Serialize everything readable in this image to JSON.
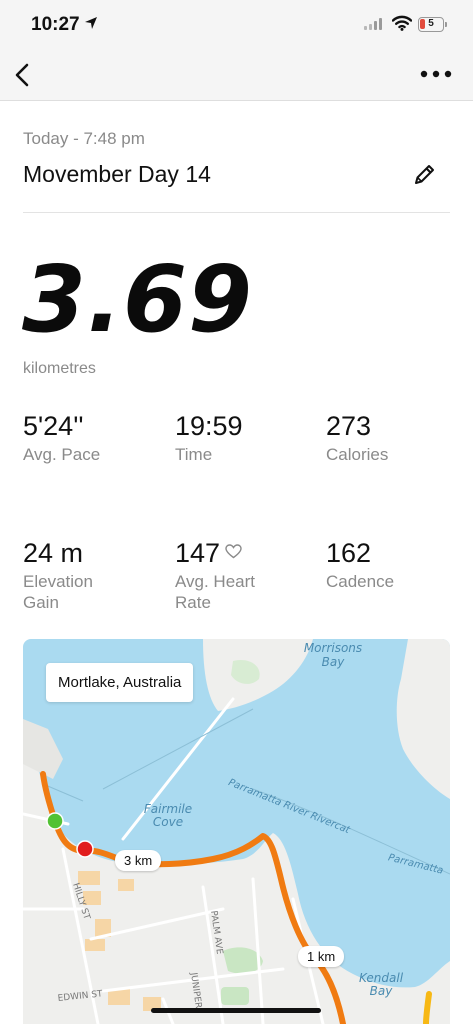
{
  "status_bar": {
    "time": "10:27",
    "battery_level": "5"
  },
  "activity": {
    "date": "Today - 7:48 pm",
    "title": "Movember Day 14",
    "distance": "3.69",
    "distance_unit": "kilometres"
  },
  "stats": [
    {
      "value": "5'24''",
      "label": "Avg. Pace"
    },
    {
      "value": "19:59",
      "label": "Time"
    },
    {
      "value": "273",
      "label": "Calories"
    },
    {
      "value": "24 m",
      "label": "Elevation Gain"
    },
    {
      "value": "147",
      "label": "Avg. Heart Rate"
    },
    {
      "value": "162",
      "label": "Cadence"
    }
  ],
  "map": {
    "location": "Mortlake, Australia",
    "place_labels": [
      "Morrisons Bay",
      "Fairmile Cove",
      "Kendall Bay",
      "Parramatta River Rivercat",
      "Parramatta"
    ],
    "street_labels": [
      "HILLY ST",
      "PALM AVE",
      "JUNIPER",
      "EDWIN ST"
    ],
    "km_markers": [
      "3 km",
      "1 km"
    ],
    "colors": {
      "water": "#aadaf0",
      "land": "#efefed",
      "route": "#f07b12",
      "start": "#52c234",
      "end": "#e11d1d"
    }
  }
}
